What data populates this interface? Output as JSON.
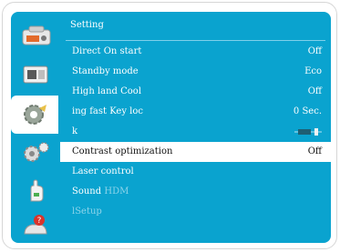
{
  "sidebar": {
    "tabs": [
      {
        "icon": "display-icon"
      },
      {
        "icon": "screen-icon"
      },
      {
        "icon": "settings-gear-icon"
      },
      {
        "icon": "advanced-gears-icon"
      },
      {
        "icon": "hand-icon"
      },
      {
        "icon": "help-icon"
      }
    ],
    "active_index": 2
  },
  "menu": {
    "title": "Setting",
    "items": [
      {
        "label": "Direct On start",
        "value": "Off"
      },
      {
        "label": "Standby mode",
        "value": "Eco"
      },
      {
        "label": "High land  Cool",
        "value": "Off"
      },
      {
        "label": "ing fast  Key loc",
        "value": "0 Sec."
      },
      {
        "label": "k",
        "value": ""
      },
      {
        "label": "Contrast optimization",
        "value": "Off"
      },
      {
        "label": "Laser control",
        "value": ""
      },
      {
        "label": "Sound",
        "value": "",
        "extra": "HDM"
      },
      {
        "label": "lSetup",
        "value": ""
      }
    ],
    "selected_index": 5
  },
  "colors": {
    "panel": "#0aa3cf",
    "text": "#ffffff",
    "selected_bg": "#ffffff",
    "disabled_text": "#8ed4ea"
  }
}
